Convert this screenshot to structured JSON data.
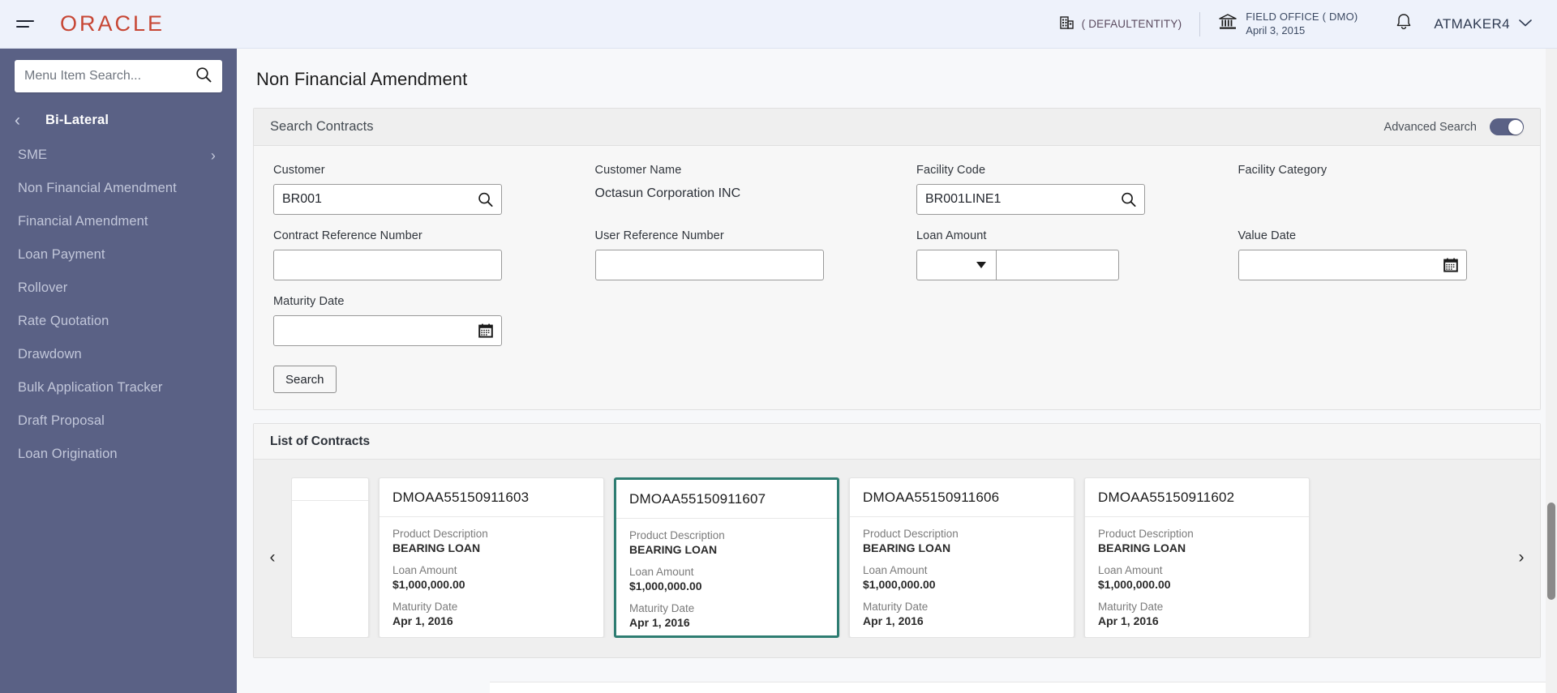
{
  "header": {
    "logo_text": "ORACLE",
    "menu_icon": "hamburger-icon",
    "entity": {
      "icon": "building-icon",
      "label": "( DEFAULTENTITY)"
    },
    "branch": {
      "icon": "bank-icon",
      "name": "FIELD OFFICE ( DMO)",
      "date": "April 3, 2015"
    },
    "notifications_icon": "bell-icon",
    "user": {
      "name": "ATMAKER4",
      "chevron_icon": "chevron-down-icon"
    }
  },
  "sidebar": {
    "search": {
      "placeholder": "Menu Item Search...",
      "value": "",
      "icon": "search-icon"
    },
    "section": {
      "back_icon": "chevron-left-icon",
      "title": "Bi-Lateral"
    },
    "items": [
      {
        "label": "SME",
        "has_chevron": true,
        "chevron_icon": "chevron-right-icon"
      },
      {
        "label": "Non Financial Amendment",
        "has_chevron": false
      },
      {
        "label": "Financial Amendment",
        "has_chevron": false
      },
      {
        "label": "Loan Payment",
        "has_chevron": false
      },
      {
        "label": "Rollover",
        "has_chevron": false
      },
      {
        "label": "Rate Quotation",
        "has_chevron": false
      },
      {
        "label": "Drawdown",
        "has_chevron": false
      },
      {
        "label": "Bulk Application Tracker",
        "has_chevron": false
      },
      {
        "label": "Draft Proposal",
        "has_chevron": false
      },
      {
        "label": "Loan Origination",
        "has_chevron": false
      }
    ]
  },
  "page": {
    "title": "Non Financial Amendment"
  },
  "search_panel": {
    "title": "Search Contracts",
    "advanced_search_label": "Advanced Search",
    "advanced_search_on": true,
    "fields": {
      "customer": {
        "label": "Customer",
        "value": "BR001",
        "placeholder": "",
        "icon": "search-icon"
      },
      "customer_name": {
        "label": "Customer Name",
        "value": "Octasun Corporation INC"
      },
      "facility_code": {
        "label": "Facility Code",
        "value": "BR001LINE1",
        "placeholder": "",
        "icon": "search-icon"
      },
      "facility_category": {
        "label": "Facility Category",
        "value": ""
      },
      "contract_reference_number": {
        "label": "Contract Reference Number",
        "value": "",
        "placeholder": ""
      },
      "user_reference_number": {
        "label": "User Reference Number",
        "value": "",
        "placeholder": ""
      },
      "loan_amount": {
        "label": "Loan Amount",
        "currency": "",
        "currency_icon": "chevron-down-icon",
        "value": "",
        "placeholder": ""
      },
      "value_date": {
        "label": "Value Date",
        "value": "",
        "placeholder": "",
        "icon": "calendar-icon"
      },
      "maturity_date": {
        "label": "Maturity Date",
        "value": "",
        "placeholder": "",
        "icon": "calendar-icon"
      }
    },
    "search_button": "Search"
  },
  "list_panel": {
    "title": "List of Contracts",
    "prev_icon": "chevron-left-icon",
    "next_icon": "chevron-right-icon",
    "labels": {
      "product_description": "Product Description",
      "loan_amount": "Loan Amount",
      "maturity_date": "Maturity Date"
    },
    "selected_index": 1,
    "cards": [
      {
        "reference": "DMOAA55150911603",
        "product_description": "BEARING LOAN",
        "loan_amount": "$1,000,000.00",
        "maturity_date": "Apr 1, 2016",
        "selected": false
      },
      {
        "reference": "DMOAA55150911607",
        "product_description": "BEARING LOAN",
        "loan_amount": "$1,000,000.00",
        "maturity_date": "Apr 1, 2016",
        "selected": true
      },
      {
        "reference": "DMOAA55150911606",
        "product_description": "BEARING LOAN",
        "loan_amount": "$1,000,000.00",
        "maturity_date": "Apr 1, 2016",
        "selected": false
      },
      {
        "reference": "DMOAA55150911602",
        "product_description": "BEARING LOAN",
        "loan_amount": "$1,000,000.00",
        "maturity_date": "Apr 1, 2016",
        "selected": false
      }
    ]
  },
  "colors": {
    "brand_red": "#c74634",
    "sidebar_bg": "#5a6185",
    "header_bg": "#eef2fb",
    "selected_card_border": "#2e7d72",
    "toggle_on": "#5a6185"
  }
}
